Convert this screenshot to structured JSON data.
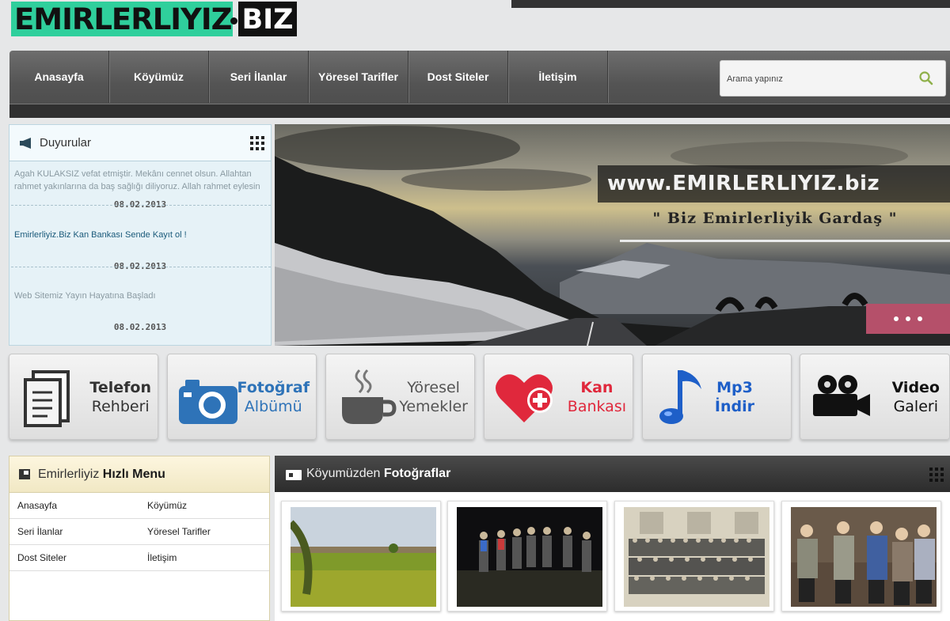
{
  "logo": {
    "main": "EMIRLERLIYIZ",
    "ext": "BIZ"
  },
  "nav": {
    "items": [
      {
        "label": "Anasayfa"
      },
      {
        "label": "Köyümüz"
      },
      {
        "label": "Seri İlanlar"
      },
      {
        "label": "Yöresel Tarifler"
      },
      {
        "label": "Dost Siteler"
      },
      {
        "label": "İletişim"
      }
    ],
    "search_placeholder": "Arama yapınız",
    "search_icon": "search-icon"
  },
  "announcements": {
    "title": "Duyurular",
    "items": [
      {
        "text": "Agah KULAKSIZ vefat etmiştir. Mekânı cennet olsun. Allahtan rahmet yakınlarına da baş sağlığı diliyoruz. Allah rahmet eylesin",
        "date": "08.02.2013"
      },
      {
        "text": "Emirlerliyiz.Biz Kan Bankası Sende Kayıt ol !",
        "date": "08.02.2013"
      },
      {
        "text": "Web Sitemiz Yayın Hayatına Başladı",
        "date": "08.02.2013"
      }
    ]
  },
  "slider": {
    "banner_title": "www.EMIRLERLIYIZ.biz",
    "banner_sub": "\" Biz Emirlerliyik Gardaş \""
  },
  "tiles": [
    {
      "line1": "Telefon",
      "line2": "Rehberi",
      "color": "#333333",
      "icon": "phonebook-icon"
    },
    {
      "line1": "Fotoğraf",
      "line2": "Albümü",
      "color": "#2e73b8",
      "icon": "camera-icon"
    },
    {
      "line1": "Yöresel",
      "line2": "Yemekler",
      "color": "#555555",
      "icon": "cup-icon"
    },
    {
      "line1": "Kan",
      "line2": "Bankası",
      "color": "#e0283c",
      "icon": "heart-plus-icon"
    },
    {
      "line1": "Mp3",
      "line2": "İndir",
      "color": "#1e5fc8",
      "icon": "music-note-icon"
    },
    {
      "line1": "Video",
      "line2": "Galeri",
      "color": "#111111",
      "icon": "video-camera-icon"
    }
  ],
  "quick_menu": {
    "title_a": "Emirlerliyiz",
    "title_b": "Hızlı Menu",
    "rows": [
      [
        "Anasayfa",
        "Köyümüz"
      ],
      [
        "Seri İlanlar",
        "Yöresel Tarifler"
      ],
      [
        "Dost Siteler",
        "İletişim"
      ]
    ]
  },
  "photos": {
    "title_a": "Köyumüzden",
    "title_b": "Fotoğraflar"
  }
}
